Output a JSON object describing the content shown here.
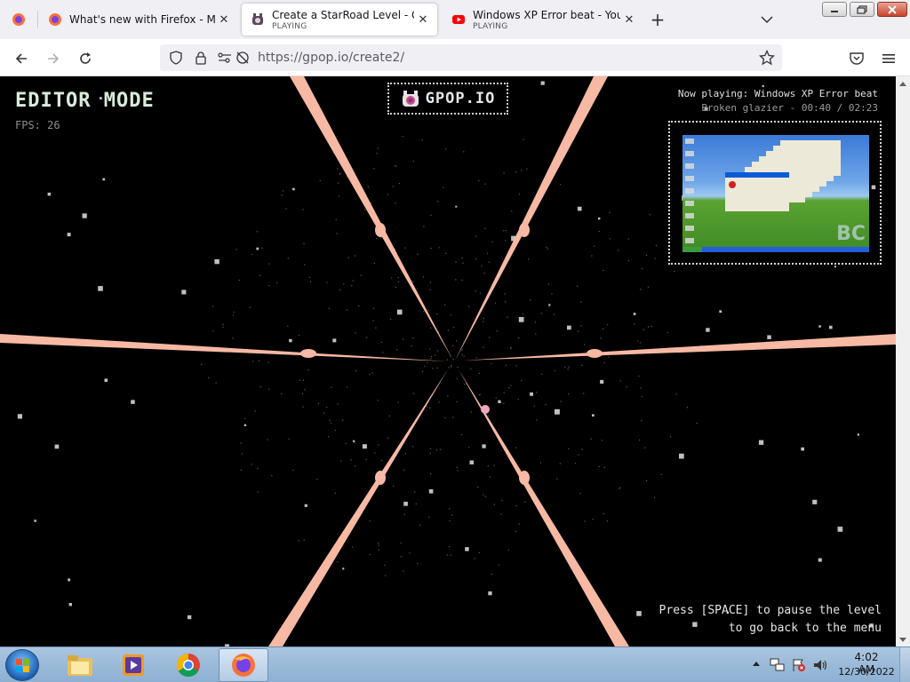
{
  "browser": {
    "tabs": [
      {
        "title": "What's new with Firefox - More",
        "subtitle": "",
        "icon": "firefox-icon"
      },
      {
        "title": "Create a StarRoad Level - Gpop",
        "subtitle": "PLAYING",
        "icon": "gpop-icon"
      },
      {
        "title": "Windows XP Error beat - YouTu",
        "subtitle": "PLAYING",
        "icon": "youtube-icon"
      }
    ],
    "url": "https://gpop.io/create2/"
  },
  "game": {
    "mode_title": "EDITOR MODE",
    "fps": "FPS: 26",
    "logo": "GPOP.IO",
    "now_playing": "Now playing: Windows XP Error beat",
    "track_info": "Broken glazier - 00:40 / 02:23",
    "hint_line1": "Press [SPACE] to pause the level",
    "hint_line2": "to go back to the menu",
    "accent_color": "#f7b9a3"
  },
  "taskbar": {
    "time": "4:02 AM",
    "date": "12/30/2022",
    "apps": [
      "explorer-icon",
      "media-player-icon",
      "chrome-icon",
      "firefox-icon"
    ]
  }
}
